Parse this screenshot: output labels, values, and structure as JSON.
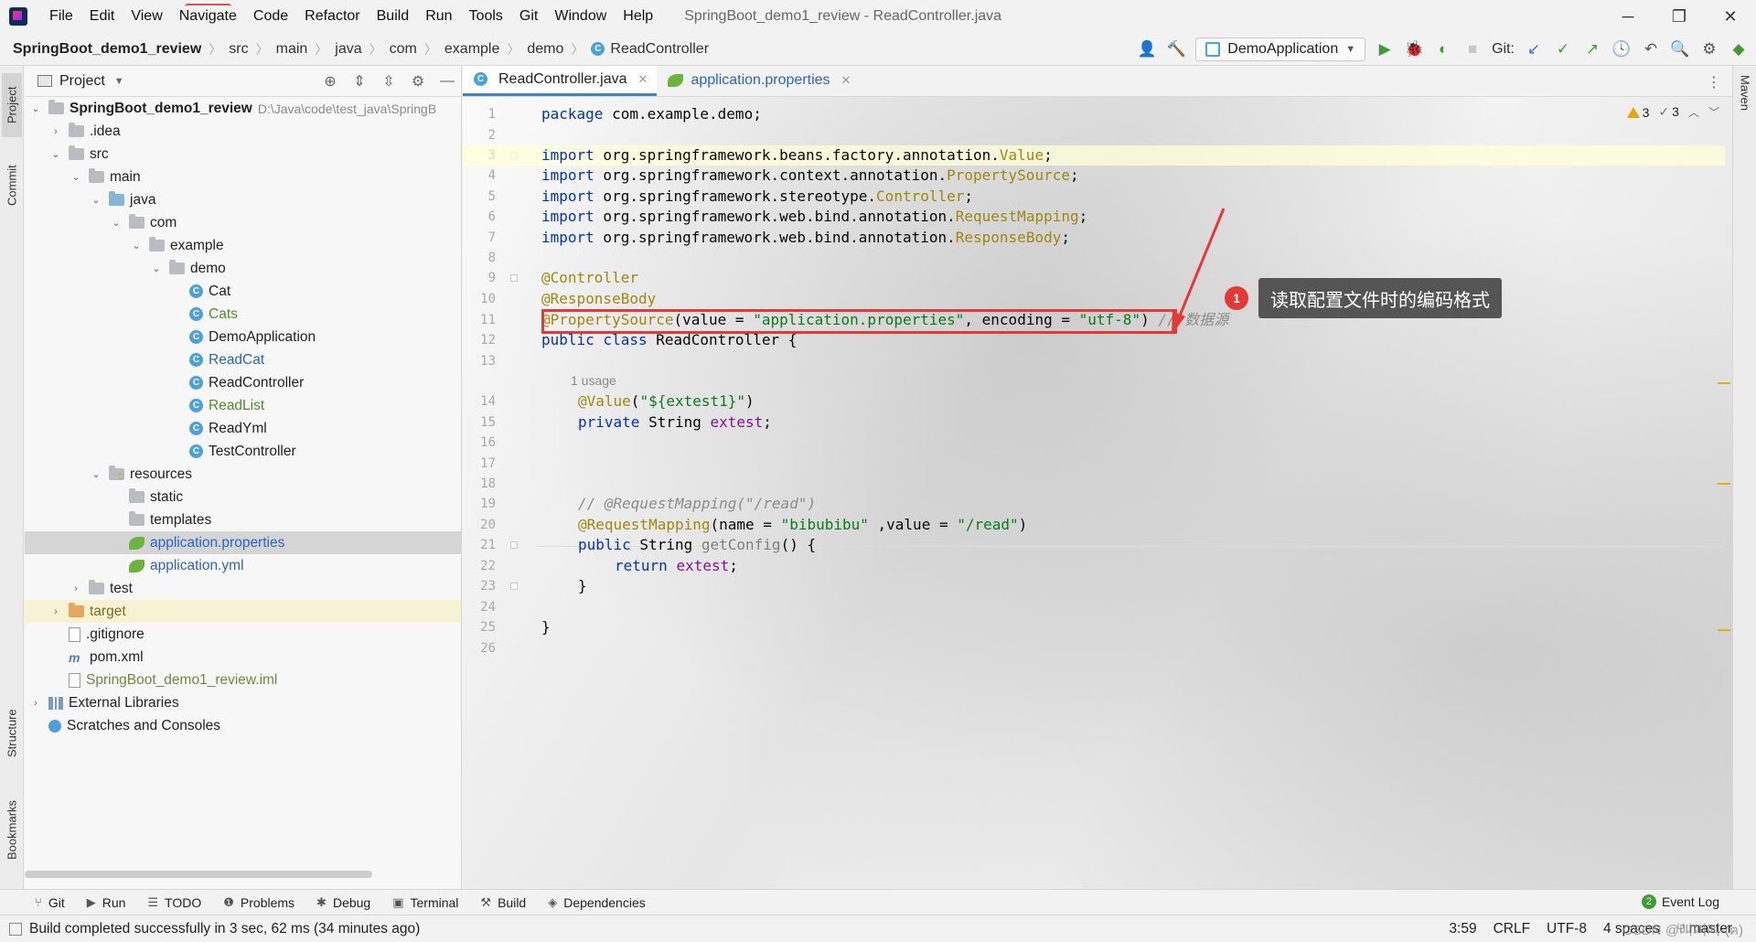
{
  "menu": {
    "items": [
      "File",
      "Edit",
      "View",
      "Navigate",
      "Code",
      "Refactor",
      "Build",
      "Run",
      "Tools",
      "Git",
      "Window",
      "Help"
    ],
    "window_title": "SpringBoot_demo1_review - ReadController.java"
  },
  "window_controls": {
    "minimize": "─",
    "restore": "❐",
    "close": "✕"
  },
  "breadcrumb": {
    "items": [
      "SpringBoot_demo1_review",
      "src",
      "main",
      "java",
      "com",
      "example",
      "demo",
      "ReadController"
    ]
  },
  "toolbar": {
    "run_config": "DemoApplication",
    "git_label": "Git:"
  },
  "stripes": {
    "project": "Project",
    "commit": "Commit",
    "structure": "Structure",
    "bookmarks": "Bookmarks",
    "maven": "Maven"
  },
  "project_panel": {
    "title": "Project",
    "tree": [
      {
        "label": "SpringBoot_demo1_review",
        "detail": "D:\\Java\\code\\test_java\\SpringB"
      },
      {
        "label": ".idea"
      },
      {
        "label": "src"
      },
      {
        "label": "main"
      },
      {
        "label": "java"
      },
      {
        "label": "com"
      },
      {
        "label": "example"
      },
      {
        "label": "demo"
      },
      {
        "label": "Cat"
      },
      {
        "label": "Cats"
      },
      {
        "label": "DemoApplication"
      },
      {
        "label": "ReadCat"
      },
      {
        "label": "ReadController"
      },
      {
        "label": "ReadList"
      },
      {
        "label": "ReadYml"
      },
      {
        "label": "TestController"
      },
      {
        "label": "resources"
      },
      {
        "label": "static"
      },
      {
        "label": "templates"
      },
      {
        "label": "application.properties"
      },
      {
        "label": "application.yml"
      },
      {
        "label": "test"
      },
      {
        "label": "target"
      },
      {
        "label": ".gitignore"
      },
      {
        "label": "pom.xml"
      },
      {
        "label": "SpringBoot_demo1_review.iml"
      },
      {
        "label": "External Libraries"
      },
      {
        "label": "Scratches and Consoles"
      }
    ]
  },
  "editor": {
    "tabs": [
      {
        "label": "ReadController.java"
      },
      {
        "label": "application.properties"
      }
    ],
    "inspections": {
      "warnings": "3",
      "ok": "3"
    },
    "line_numbers": [
      "1",
      "2",
      "3",
      "4",
      "5",
      "6",
      "7",
      "8",
      "9",
      "10",
      "11",
      "12",
      "13",
      "14",
      "15",
      "16",
      "17",
      "18",
      "19",
      "20",
      "21",
      "22",
      "23",
      "24",
      "25",
      "26"
    ],
    "code": {
      "l1_kw": "package",
      "l1_rest": " com.example.demo;",
      "l3_kw": "import",
      "l3_rest": " org.springframework.beans.factory.annotation.",
      "l3_ann": "Value",
      "l3_end": ";",
      "l4_kw": "import",
      "l4_rest": " org.springframework.context.annotation.",
      "l4_ann": "PropertySource",
      "l4_end": ";",
      "l5_kw": "import",
      "l5_rest": " org.springframework.stereotype.",
      "l5_ann": "Controller",
      "l5_end": ";",
      "l6_kw": "import",
      "l6_rest": " org.springframework.web.bind.annotation.",
      "l6_ann": "RequestMapping",
      "l6_end": ";",
      "l7_kw": "import",
      "l7_rest": " org.springframework.web.bind.annotation.",
      "l7_ann": "ResponseBody",
      "l7_end": ";",
      "l9_ann": "@Controller",
      "l10_ann": "@ResponseBody",
      "l11_ann": "@PropertySource",
      "l11_a": "(value = ",
      "l11_s1": "\"application.properties\"",
      "l11_b": ", encoding = ",
      "l11_s2": "\"utf-8\"",
      "l11_c": ")",
      "l11_cmt": " // 数据源",
      "l12_kw": "public class",
      "l12_rest": " ReadController {",
      "usage_hint": "1 usage",
      "l14_ann": "@Value",
      "l14_a": "(",
      "l14_s": "\"${extest1}\"",
      "l14_b": ")",
      "l15_kw": "private",
      "l15_rest": " String ",
      "l15_fld": "extest",
      "l15_end": ";",
      "l19_cmt": "// @RequestMapping(\"/read\")",
      "l20_ann": "@RequestMapping",
      "l20_a": "(name = ",
      "l20_s1": "\"bibubibu\"",
      "l20_b": " ,value = ",
      "l20_s2": "\"/read\"",
      "l20_c": ")",
      "l21_kw": "public",
      "l21_rest": " String ",
      "l21_m": "getConfig",
      "l21_end": "() {",
      "l22_kw": "return",
      "l22_sp": " ",
      "l22_fld": "extest",
      "l22_end": ";",
      "l23": "}",
      "l25": "}"
    }
  },
  "callout": {
    "number": "1",
    "text": "读取配置文件时的编码格式"
  },
  "tool_windows": {
    "items": [
      "Git",
      "Run",
      "TODO",
      "Problems",
      "Debug",
      "Terminal",
      "Build",
      "Dependencies"
    ],
    "event_log": "Event Log",
    "event_count": "2"
  },
  "status": {
    "message": "Build completed successfully in 3 sec, 62 ms (34 minutes ago)",
    "position": "3:59",
    "line_sep": "CRLF",
    "encoding": "UTF-8",
    "indent": "4 spaces",
    "branch": "master",
    "watermark": "CSDN @叫叫叫-(ฅ)"
  },
  "colors": {
    "keyword": "#0033b3",
    "annotation": "#9e880d",
    "string": "#067d17",
    "highlight_box": "#e53935"
  }
}
